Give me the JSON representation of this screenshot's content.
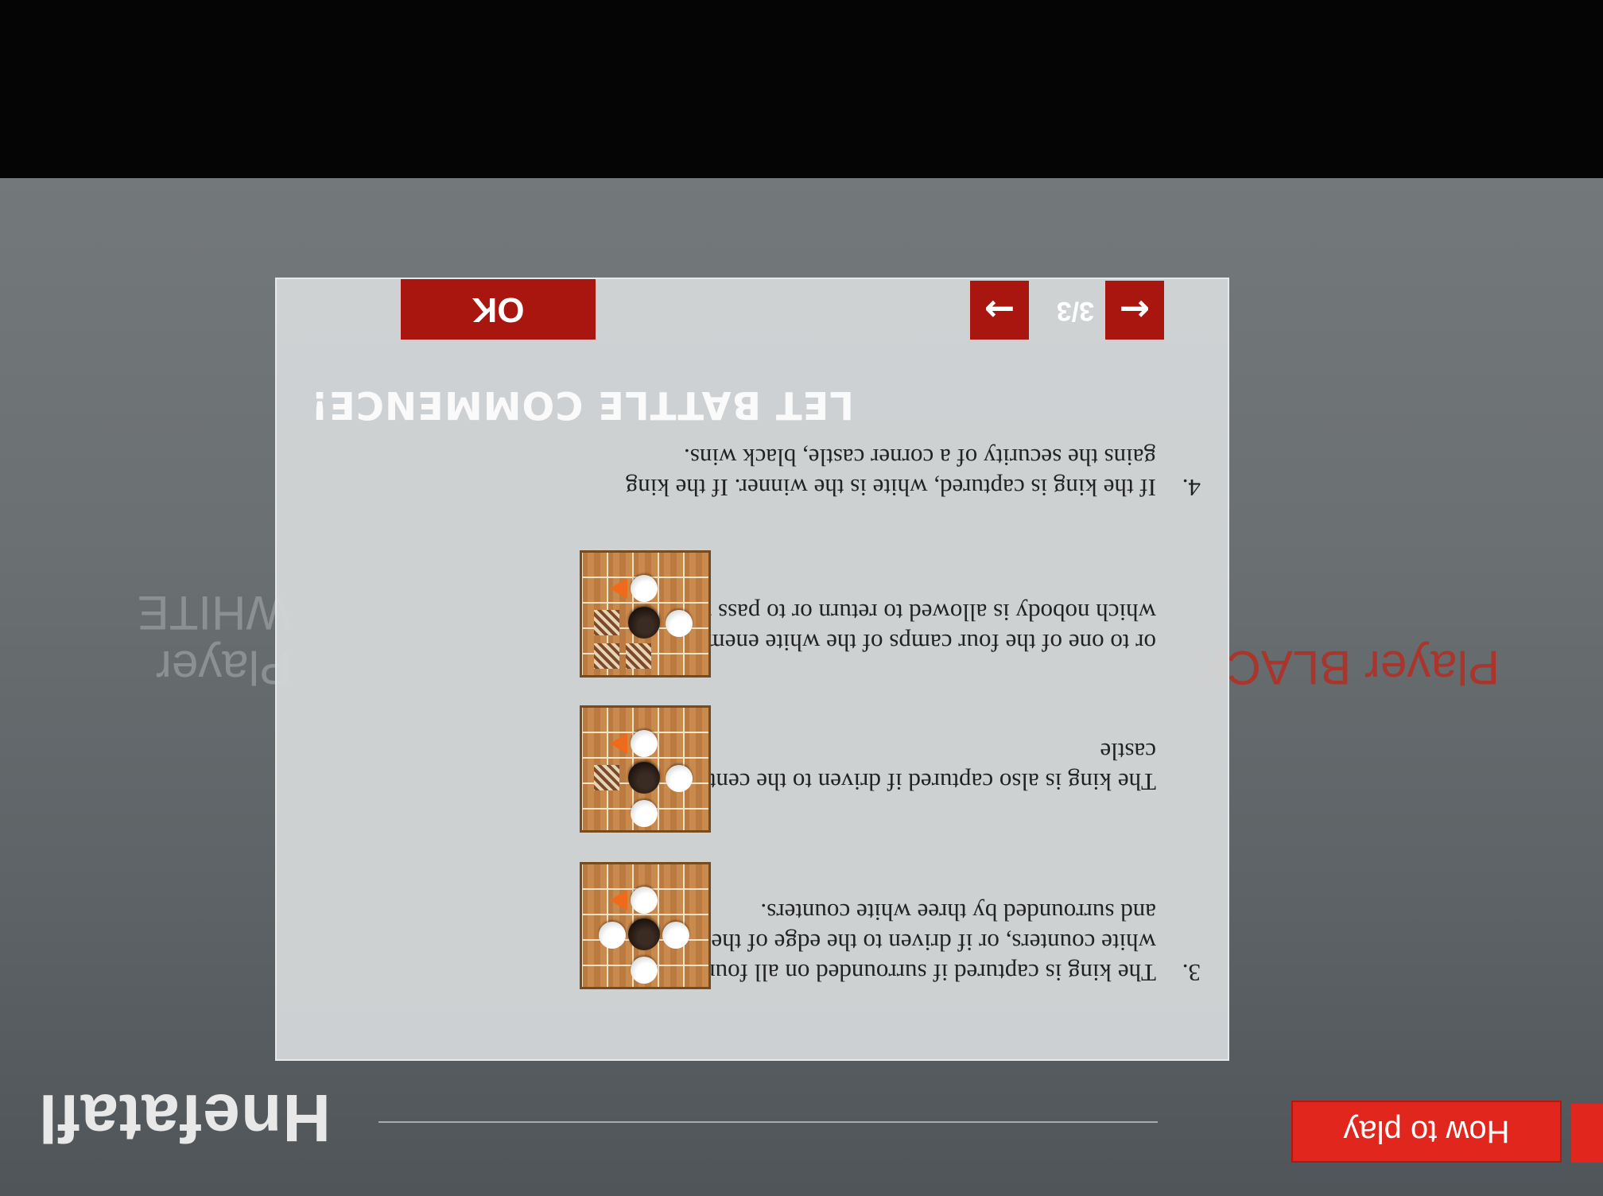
{
  "app": {
    "title": "Hnefatafl"
  },
  "header": {
    "how_to_play_label": "How to play"
  },
  "players": {
    "white": "Player WHITE",
    "black": "Player BLACK"
  },
  "dialog": {
    "rules": [
      {
        "number": "3.",
        "text": "The king is captured if surrounded on all four sides by white counters, or if driven to the edge of the board and surrounded by three white counters."
      },
      {
        "number": "",
        "text": "The king is also captured if driven to the center-square castle"
      },
      {
        "number": "",
        "text": "or to one of the four camps of the white enemies to which nobody is allowed to return or to pass through."
      },
      {
        "number": "4.",
        "text": "If the king is captured, white is the winner. If the king gains the security of a corner castle, black wins."
      }
    ],
    "battle_title": "LET BATTLE COMMENCE!",
    "page_indicator": "3/3",
    "prev_icon": "←",
    "next_icon": "→",
    "ok_label": "OK"
  },
  "colors": {
    "accent": "#a8160f",
    "button_red": "#e0261d"
  }
}
